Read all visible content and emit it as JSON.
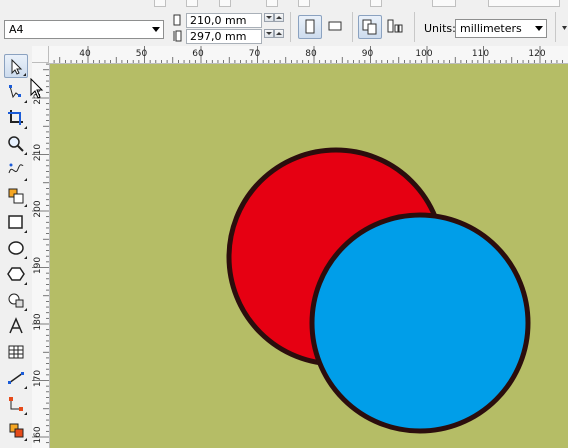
{
  "colors": {
    "page_background": "#b5bd66",
    "red_fill": "#e60012",
    "blue_fill": "#009ee9",
    "outline": "#2b0d0d"
  },
  "propbar": {
    "page_size": "A4",
    "width_value": "210,0 mm",
    "height_value": "297,0 mm",
    "units_label": "Units:",
    "units_value": "millimeters"
  },
  "ruler": {
    "horizontal_ticks": [
      "40",
      "50",
      "60",
      "70",
      "80",
      "90",
      "100",
      "110",
      "120"
    ],
    "vertical_ticks": [
      "220",
      "210",
      "200",
      "190",
      "180",
      "170",
      "160"
    ]
  },
  "toolbox": {
    "tools": [
      {
        "name": "pick-tool",
        "icon": "arrow-pointer-icon",
        "active": true
      },
      {
        "name": "shape-tool",
        "icon": "shape-node-icon"
      },
      {
        "name": "crop-tool",
        "icon": "crop-icon"
      },
      {
        "name": "zoom-tool",
        "icon": "magnifier-icon"
      },
      {
        "name": "freehand-tool",
        "icon": "freehand-curve-icon"
      },
      {
        "name": "smart-fill-tool",
        "icon": "smart-fill-icon"
      },
      {
        "name": "rectangle-tool",
        "icon": "rectangle-icon"
      },
      {
        "name": "ellipse-tool",
        "icon": "ellipse-icon"
      },
      {
        "name": "polygon-tool",
        "icon": "polygon-icon"
      },
      {
        "name": "basic-shapes-tool",
        "icon": "basic-shapes-icon"
      },
      {
        "name": "text-tool",
        "icon": "text-a-icon"
      },
      {
        "name": "table-tool",
        "icon": "table-grid-icon"
      },
      {
        "name": "dimension-tool",
        "icon": "parallel-dimension-icon"
      },
      {
        "name": "connector-tool",
        "icon": "connector-icon"
      },
      {
        "name": "interactive-fill-tool",
        "icon": "fill-bucket-icon"
      }
    ]
  },
  "canvas": {
    "shapes": [
      {
        "name": "red-circle",
        "type": "ellipse",
        "fill": "#e60012",
        "outline": "#2b0d0d"
      },
      {
        "name": "blue-circle",
        "type": "ellipse",
        "fill": "#009ee9",
        "outline": "#2b0d0d"
      }
    ]
  }
}
